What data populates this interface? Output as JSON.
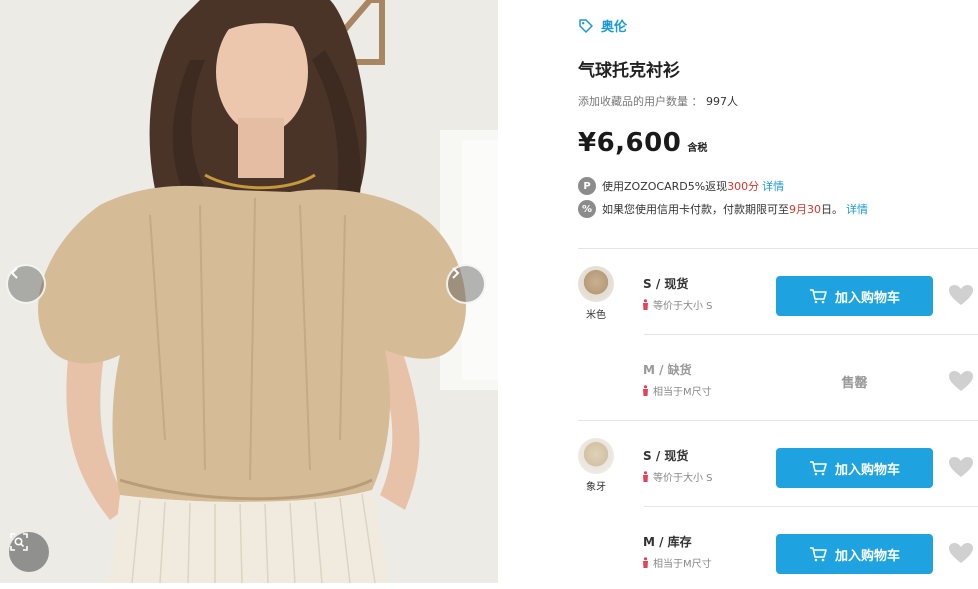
{
  "photo": {
    "prev_icon": "chevron-left-icon",
    "next_icon": "chevron-right-icon",
    "zoom_icon": "magnify-icon"
  },
  "brand": {
    "icon": "tag-icon",
    "name": "奥伦"
  },
  "product": {
    "title": "气球托克衬衫",
    "fav_label": "添加收藏品的用户数量 ：",
    "fav_count": "997人",
    "price": "¥6,600",
    "tax": "含税"
  },
  "promos": [
    {
      "icon": "P",
      "pre": "使用ZOZOCARD5%返现",
      "highlight": "300分",
      "post": "",
      "link": "详情"
    },
    {
      "icon": "%",
      "pre": "如果您使用信用卡付款，付款期限可至",
      "highlight": "9月30",
      "post": "日。",
      "link": "详情"
    }
  ],
  "variants": [
    {
      "color": "米色",
      "size_stock": "S / 现货",
      "equiv": "等价于大小 S",
      "available": true,
      "button": "加入购物车"
    },
    {
      "color": "",
      "size_stock": "M / 缺货",
      "equiv": "相当于M尺寸",
      "available": false,
      "soldout": "售罄"
    },
    {
      "color": "象牙",
      "size_stock": "S / 现货",
      "equiv": "等价于大小 S",
      "available": true,
      "button": "加入购物车"
    },
    {
      "color": "",
      "size_stock": "M / 库存",
      "equiv": "相当于M尺寸",
      "available": true,
      "button": "加入购物车"
    }
  ],
  "colors": {
    "accent": "#1fa3e0",
    "highlight_red": "#d9362b",
    "heart": "#d0d0d0"
  }
}
